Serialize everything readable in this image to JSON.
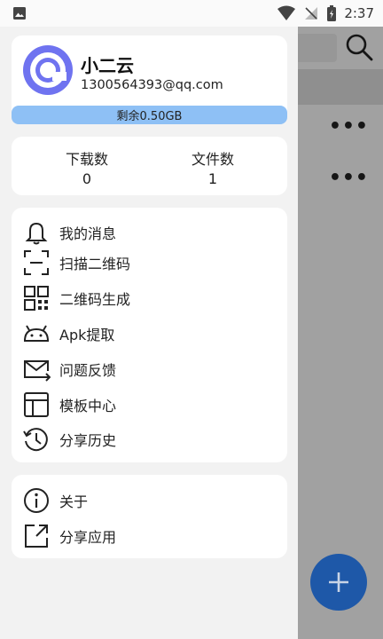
{
  "status_bar": {
    "time": "2:37",
    "icons": [
      "image-icon",
      "wifi-icon",
      "no-signal-icon",
      "battery-icon"
    ]
  },
  "profile": {
    "name": "小二云",
    "email": "1300564393@qq.com",
    "quota": "剩余0.50GB"
  },
  "stats": [
    {
      "label": "下载数",
      "value": "0"
    },
    {
      "label": "文件数",
      "value": "1"
    }
  ],
  "menu": [
    {
      "label": "我的消息",
      "icon": "bell-icon"
    },
    {
      "label": "扫描二维码",
      "icon": "scan-icon"
    },
    {
      "label": "二维码生成",
      "icon": "qr-code-icon"
    },
    {
      "label": "Apk提取",
      "icon": "android-icon"
    },
    {
      "label": "问题反馈",
      "icon": "mail-icon"
    },
    {
      "label": "模板中心",
      "icon": "template-icon"
    },
    {
      "label": "分享历史",
      "icon": "history-icon"
    }
  ],
  "menu2": [
    {
      "label": "关于",
      "icon": "info-icon"
    },
    {
      "label": "分享应用",
      "icon": "share-icon"
    }
  ],
  "colors": {
    "accent": "#1e58a8",
    "quota_bar": "#8ec0f5",
    "avatar_ring": "#6f73f0"
  }
}
